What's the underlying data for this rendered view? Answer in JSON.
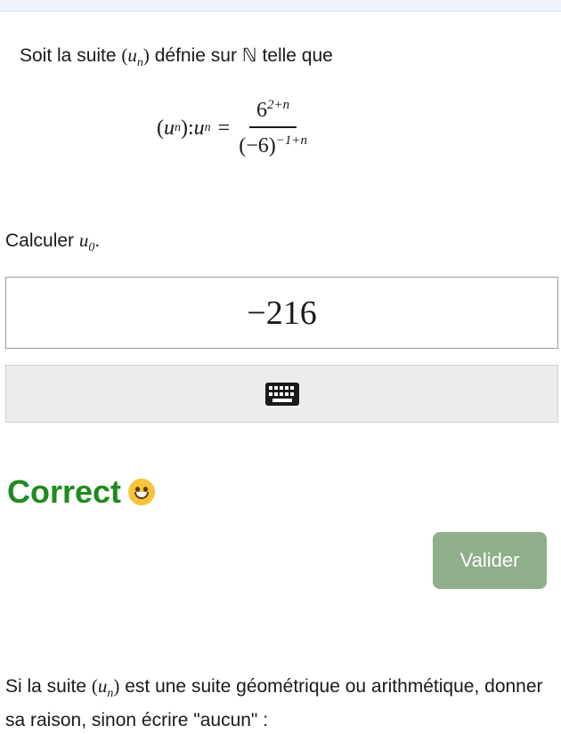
{
  "statement": {
    "before": "Soit la suite ",
    "seq_var": "u",
    "seq_sub": "n",
    "after": " défnie sur ℕ telle que"
  },
  "formula": {
    "lhs_var": "u",
    "lhs_sub": "n",
    "colon": " : ",
    "u_var": "u",
    "u_sub": "n",
    "equals": "=",
    "num_base": "6",
    "num_exp": "2+n",
    "den_base": "(−6)",
    "den_exp": "−1+n"
  },
  "prompt": {
    "text": "Calculer ",
    "var": "u",
    "sub": "0",
    "end": "."
  },
  "answer": {
    "value": "−216"
  },
  "keyboard": {
    "icon": "keyboard-icon"
  },
  "feedback": {
    "text": "Correct",
    "icon": "smiley-icon",
    "color": "#1f8a1f"
  },
  "actions": {
    "submit_label": "Valider",
    "color": "#8fae8a"
  },
  "question2": {
    "before": "Si la suite ",
    "var": "u",
    "sub": "n",
    "after": " est une suite géométrique ou arithmétique, donner sa raison, sinon écrire \"aucun\" :"
  }
}
